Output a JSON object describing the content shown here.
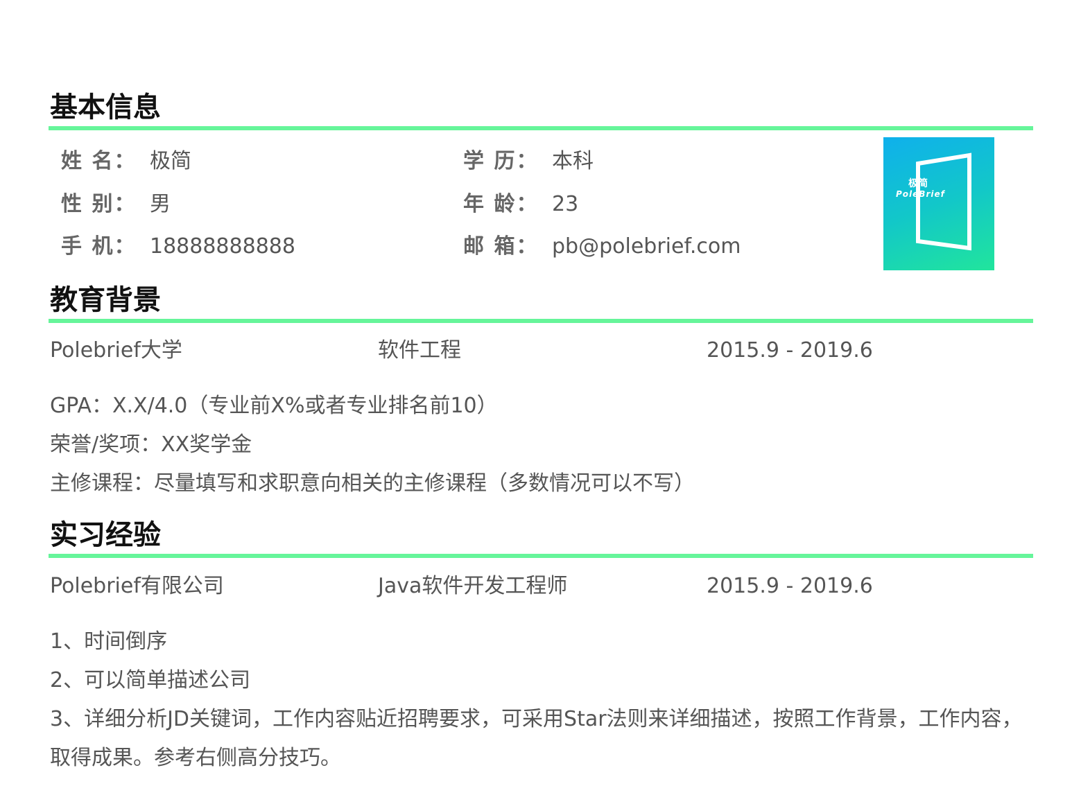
{
  "basic": {
    "title": "基本信息",
    "name_label": "姓 名：",
    "name_value": "极简",
    "gender_label": "性 别：",
    "gender_value": "男",
    "phone_label": "手 机：",
    "phone_value": "18888888888",
    "edu_label": "学 历：",
    "edu_value": "本科",
    "age_label": "年 龄：",
    "age_value": "23",
    "email_label": "邮 箱：",
    "email_value": "pb@polebrief.com",
    "photo_line1": "极简",
    "photo_line2": "PoleBrief"
  },
  "education": {
    "title": "教育背景",
    "school": "Polebrief大学",
    "major": "软件工程",
    "period": "2015.9 - 2019.6",
    "details": [
      "GPA：X.X/4.0（专业前X%或者专业排名前10）",
      "荣誉/奖项：XX奖学金",
      "主修课程：尽量填写和求职意向相关的主修课程（多数情况可以不写）"
    ]
  },
  "internship": {
    "title": "实习经验",
    "company": "Polebrief有限公司",
    "position": "Java软件开发工程师",
    "period": "2015.9 - 2019.6",
    "details": [
      "1、时间倒序",
      "2、可以简单描述公司",
      "3、详细分析JD关键词，工作内容贴近招聘要求，可采用Star法则来详细描述，按照工作背景，工作内容，取得成果。参考右侧高分技巧。"
    ]
  },
  "colors": {
    "accent": "#66f59a",
    "title": "#111111",
    "text": "#555555"
  }
}
